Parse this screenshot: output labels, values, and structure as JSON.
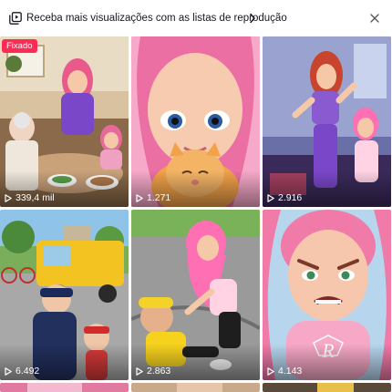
{
  "banner": {
    "text": "Receba mais visualizações com as listas de reprodução",
    "icons": {
      "playlist": "playlist-icon",
      "chevron": "chevron-right-icon",
      "close": "close-icon"
    }
  },
  "videos": [
    {
      "views": "339,4 mil",
      "badge": "Fixado"
    },
    {
      "views": "1.271"
    },
    {
      "views": "2.916"
    },
    {
      "views": "6.492"
    },
    {
      "views": "2.863"
    },
    {
      "views": "4.143"
    }
  ],
  "colors": {
    "pinned_badge": "#fe2c55",
    "text": "#161823"
  }
}
